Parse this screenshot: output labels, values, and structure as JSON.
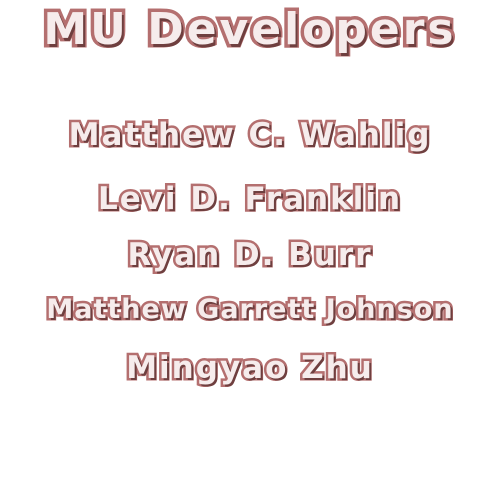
{
  "title": "MU Developers",
  "developers": [
    "Matthew C. Wahlig",
    "Levi D. Franklin",
    "Ryan D. Burr",
    "Matthew Garrett Johnson",
    "Mingyao Zhu"
  ]
}
